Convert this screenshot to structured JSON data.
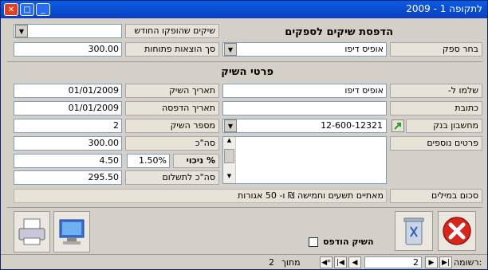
{
  "window": {
    "title": "לתקופה 1 - 2009",
    "title_prefix": "ל"
  },
  "header": {
    "form_title": "הדפסת שיקים לספקים",
    "checks_issued_label": "שיקים שהופקו החודש",
    "checks_issued_value": "",
    "supplier_label": "בחר ספק",
    "supplier_value": "אופיס דיפו",
    "opening_total_label": "סך הוצאות פתוחות",
    "opening_total_value": "300.00"
  },
  "details": {
    "section_title": "פרטי השיק",
    "pay_to_label": "שלמו ל-",
    "pay_to_value": "אופיס דיפו",
    "address_label": "כתובת",
    "address_value": "",
    "bank_account_label": "מחשבון בנק",
    "bank_account_value": "12-600-12321",
    "extra_details_label": "פרטים נוספים",
    "extra_details_value": "",
    "check_date_label": "תאריך השיק",
    "check_date_value": "01/01/2009",
    "print_date_label": "תאריך הדפסה",
    "print_date_value": "01/01/2009",
    "check_number_label": "מספר השיק",
    "check_number_value": "2",
    "total_label": "סה\"כ",
    "total_value": "300.00",
    "discount_label": "% ניכוי",
    "discount_percent": "1.50%",
    "discount_value": "4.50",
    "total_to_pay_label": "סה\"כ לתשלום",
    "total_to_pay_value": "295.50",
    "amount_words_label": "סכום במילים",
    "amount_words_value": "מאתיים תשעים וחמישה  ₪ ו- 50 אגורות"
  },
  "actions": {
    "printed_checkbox_label": "השיק הודפס",
    "printed_checked": false
  },
  "navigator": {
    "record_label": "רשומה:",
    "current": "2",
    "of_label": "מתוך",
    "total": "2"
  },
  "icons": [
    "close-icon",
    "delete-icon",
    "preview-icon",
    "print-icon",
    "bank-link-icon"
  ],
  "colors": {
    "accent": "#0a5ce6",
    "delete_red": "#d8261b"
  }
}
